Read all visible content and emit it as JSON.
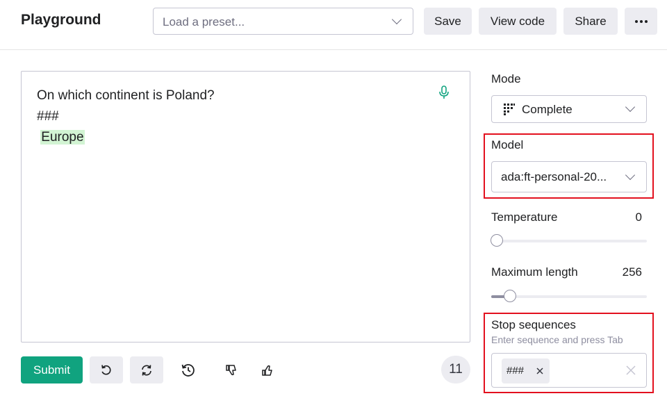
{
  "header": {
    "title": "Playground",
    "preset_placeholder": "Load a preset...",
    "save_label": "Save",
    "view_code_label": "View code",
    "share_label": "Share"
  },
  "editor": {
    "prompt_lines": [
      "On which continent is Poland?",
      "###"
    ],
    "completion": "Europe"
  },
  "actions": {
    "submit_label": "Submit",
    "token_count": "11"
  },
  "sidebar": {
    "mode": {
      "label": "Mode",
      "value": "Complete"
    },
    "model": {
      "label": "Model",
      "value": "ada:ft-personal-20..."
    },
    "temperature": {
      "label": "Temperature",
      "value": "0",
      "fraction": 0
    },
    "max_length": {
      "label": "Maximum length",
      "value": "256",
      "fraction": 0.12
    },
    "stop_sequences": {
      "label": "Stop sequences",
      "hint": "Enter sequence and press Tab",
      "chips": [
        "###"
      ]
    }
  },
  "colors": {
    "accent": "#10a37f",
    "completion_highlight": "#d2f4d3",
    "annotation_box": "#e3101e",
    "button_bg": "#ececf1"
  },
  "icons": [
    "chevron-down-icon",
    "more-dots-icon",
    "microphone-icon",
    "undo-icon",
    "regenerate-icon",
    "history-icon",
    "thumbs-down-icon",
    "thumbs-up-icon",
    "complete-mode-icon",
    "close-icon"
  ]
}
